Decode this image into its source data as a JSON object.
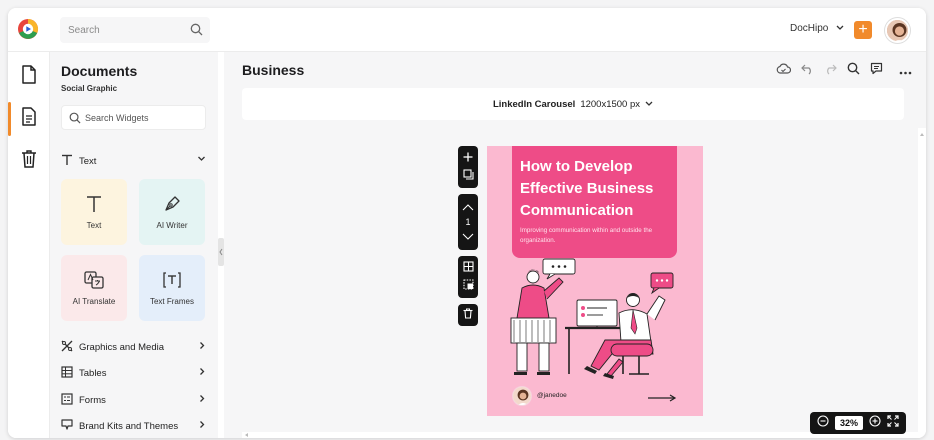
{
  "topbar": {
    "search_placeholder": "Search",
    "account_name": "DocHipo",
    "plus_label": "+"
  },
  "rail": {
    "items": [
      {
        "name": "documents",
        "icon": "file-icon"
      },
      {
        "name": "document-active",
        "icon": "file-text-icon"
      },
      {
        "name": "trash",
        "icon": "trash-icon"
      }
    ]
  },
  "panel": {
    "title": "Documents",
    "subtitle": "Social Graphic",
    "search_placeholder": "Search Widgets",
    "text_section": "Text",
    "cards": [
      {
        "label": "Text",
        "bg": "#fdf4df",
        "icon": "text-T-icon"
      },
      {
        "label": "AI Writer",
        "bg": "#e4f4f3",
        "icon": "pen-nib-icon"
      },
      {
        "label": "AI Translate",
        "bg": "#fbe9ea",
        "icon": "translate-icon"
      },
      {
        "label": "Text Frames",
        "bg": "#e4eefa",
        "icon": "text-frame-icon"
      }
    ],
    "sections": [
      {
        "label": "Graphics and Media",
        "icon": "graphics-icon"
      },
      {
        "label": "Tables",
        "icon": "table-icon"
      },
      {
        "label": "Forms",
        "icon": "form-icon"
      },
      {
        "label": "Brand Kits and Themes",
        "icon": "brand-icon"
      }
    ]
  },
  "main": {
    "title": "Business",
    "size_label": "LinkedIn Carousel",
    "size_value": "1200x1500 px",
    "page_number": "1",
    "zoom_value": "32%"
  },
  "canvas": {
    "headline": "How to Develop Effective Business Communication",
    "subline": "Improving communication within and outside the organization.",
    "handle": "@janedoe",
    "bg_color": "#fbb9d0",
    "accent_color": "#ee4c87"
  },
  "colors": {
    "brand_orange": "#f18a2b",
    "dark_toolbar": "#151515"
  }
}
